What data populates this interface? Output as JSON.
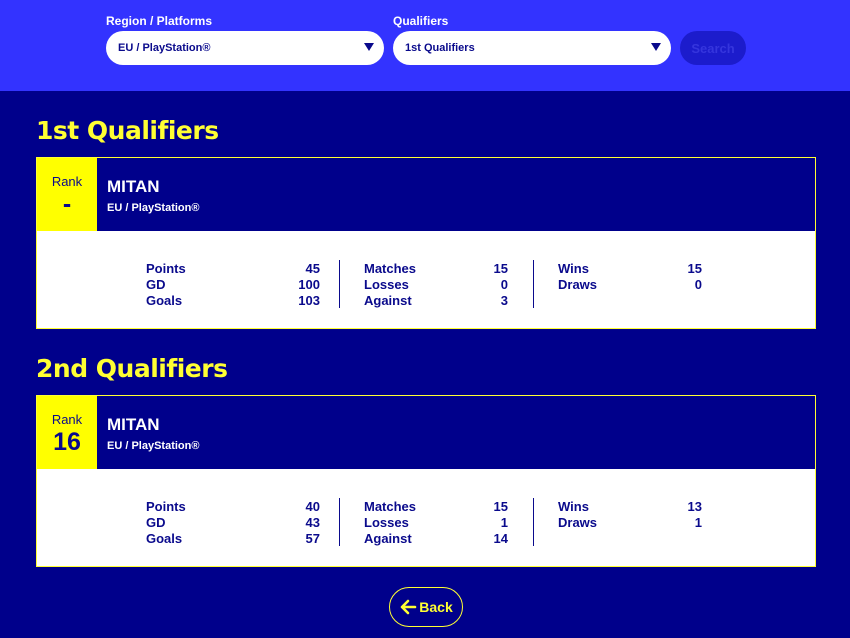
{
  "filters": {
    "region_label": "Region / Platforms",
    "region_value": "EU / PlayStation®",
    "qualifiers_label": "Qualifiers",
    "qualifiers_value": "1st Qualifiers",
    "search_label": "Search"
  },
  "sections": [
    {
      "title": "1st Qualifiers",
      "rank_label": "Rank",
      "rank_value": "-",
      "player_name": "MITAN",
      "platform": "EU / PlayStation®",
      "stats": {
        "points_label": "Points",
        "points": "45",
        "gd_label": "GD",
        "gd": "100",
        "goals_label": "Goals",
        "goals": "103",
        "matches_label": "Matches",
        "matches": "15",
        "losses_label": "Losses",
        "losses": "0",
        "against_label": "Against",
        "against": "3",
        "wins_label": "Wins",
        "wins": "15",
        "draws_label": "Draws",
        "draws": "0"
      }
    },
    {
      "title": "2nd Qualifiers",
      "rank_label": "Rank",
      "rank_value": "16",
      "player_name": "MITAN",
      "platform": "EU / PlayStation®",
      "stats": {
        "points_label": "Points",
        "points": "40",
        "gd_label": "GD",
        "gd": "43",
        "goals_label": "Goals",
        "goals": "57",
        "matches_label": "Matches",
        "matches": "15",
        "losses_label": "Losses",
        "losses": "1",
        "against_label": "Against",
        "against": "14",
        "wins_label": "Wins",
        "wins": "13",
        "draws_label": "Draws",
        "draws": "1"
      }
    }
  ],
  "back": {
    "label": "Back",
    "icon": "arrow-left-icon"
  },
  "colors": {
    "background": "#00008b",
    "topbar": "#3333ff",
    "accent_yellow": "#ffff33",
    "text_dark": "#0a0a8c"
  }
}
